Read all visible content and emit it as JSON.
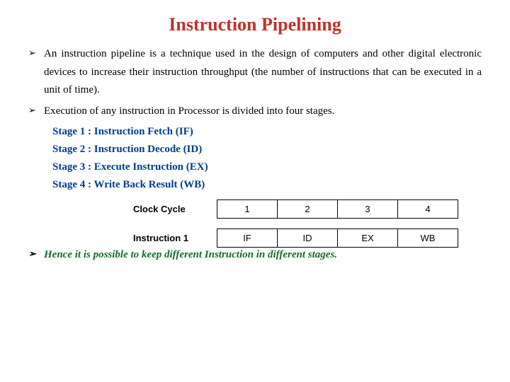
{
  "title": "Instruction Pipelining",
  "bullets": {
    "b1": "An instruction pipeline is a technique used in the design of computers and other digital electronic devices to increase their instruction throughput (the number of instructions that can be executed in a unit of time).",
    "b2": "Execution of any instruction in Processor is divided into four stages.",
    "b3": "Hence it is possible to keep different Instruction in different stages."
  },
  "stages": {
    "s1": "Stage 1 : Instruction Fetch (IF)",
    "s2": "Stage 2 : Instruction Decode (ID)",
    "s3": "Stage 3 : Execute Instruction (EX)",
    "s4": "Stage 4 : Write Back Result (WB)"
  },
  "table": {
    "row1label": "Clock Cycle",
    "row2label": "Instruction 1",
    "cycles": [
      "1",
      "2",
      "3",
      "4"
    ],
    "phases": [
      "IF",
      "ID",
      "EX",
      "WB"
    ]
  },
  "chart_data": {
    "type": "table",
    "title": "Instruction Pipelining stage table",
    "columns": [
      "Clock Cycle",
      "1",
      "2",
      "3",
      "4"
    ],
    "rows": [
      {
        "label": "Instruction 1",
        "values": [
          "IF",
          "ID",
          "EX",
          "WB"
        ]
      }
    ]
  }
}
